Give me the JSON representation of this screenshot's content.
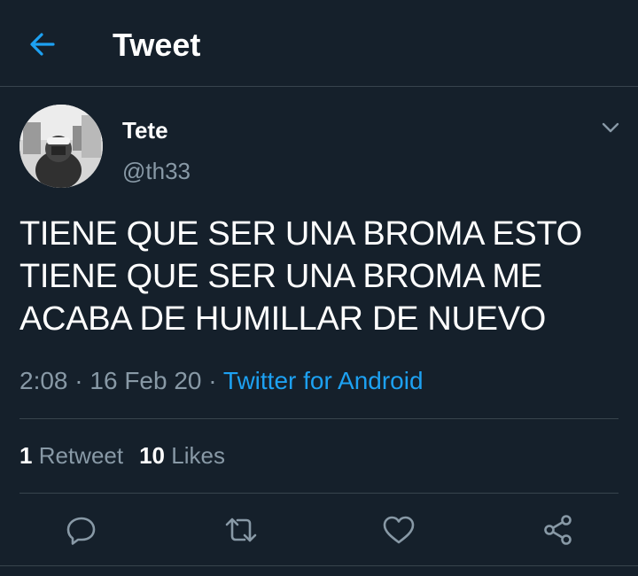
{
  "header": {
    "title": "Tweet"
  },
  "tweet": {
    "author_name": "Tete",
    "author_handle": "@th33",
    "text_lines": [
      "TIENE QUE SER UNA BROMA ESTO",
      "TIENE QUE SER UNA BROMA ME",
      "ACABA DE HUMILLAR DE NUEVO"
    ],
    "time": "2:08",
    "date": "16 Feb 20",
    "separator": "·",
    "source": "Twitter for Android",
    "retweets": {
      "count": "1",
      "label": "Retweet"
    },
    "likes": {
      "count": "10",
      "label": "Likes"
    }
  },
  "icons": {
    "back": "arrow-left-icon",
    "menu": "chevron-down-icon",
    "reply": "reply-icon",
    "retweet": "retweet-icon",
    "like": "heart-icon",
    "share": "share-icon"
  },
  "colors": {
    "background": "#15202b",
    "accent": "#1da1f2",
    "secondary_text": "#8899a6",
    "divider": "#38444d"
  }
}
